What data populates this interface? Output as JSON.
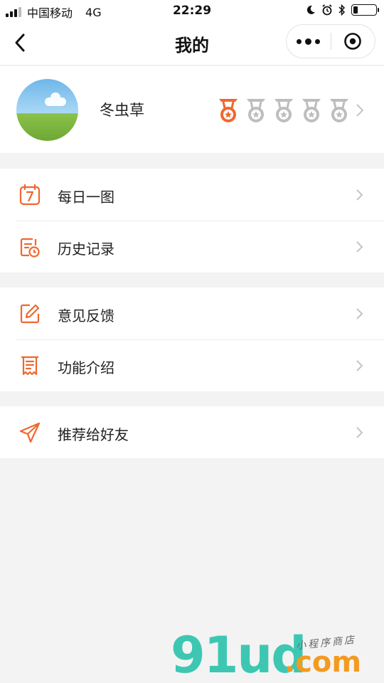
{
  "status_bar": {
    "carrier": "中国移动",
    "network": "4G",
    "time": "22:29",
    "battery_level": 0.2
  },
  "nav": {
    "title": "我的",
    "more_icon": "more-dots-icon",
    "close_icon": "target-close-icon"
  },
  "profile": {
    "username": "冬虫草",
    "medals": [
      {
        "state": "earned",
        "color": "#f0672f"
      },
      {
        "state": "locked",
        "color": "#bdbdbd"
      },
      {
        "state": "locked",
        "color": "#bdbdbd"
      },
      {
        "state": "locked",
        "color": "#bdbdbd"
      },
      {
        "state": "locked",
        "color": "#bdbdbd"
      }
    ]
  },
  "menu": {
    "group1": [
      {
        "label": "每日一图",
        "icon": "calendar-7-icon"
      },
      {
        "label": "历史记录",
        "icon": "history-clock-icon"
      }
    ],
    "group2": [
      {
        "label": "意见反馈",
        "icon": "edit-pencil-icon"
      },
      {
        "label": "功能介绍",
        "icon": "receipt-icon"
      }
    ],
    "group3": [
      {
        "label": "推荐给好友",
        "icon": "paper-plane-icon"
      }
    ]
  },
  "watermark": {
    "brand_main": "91ud",
    "brand_tld": ".com",
    "tagline": "小程序商店"
  },
  "colors": {
    "accent": "#f0672f",
    "inactive": "#bdbdbd",
    "background": "#f3f3f3"
  }
}
